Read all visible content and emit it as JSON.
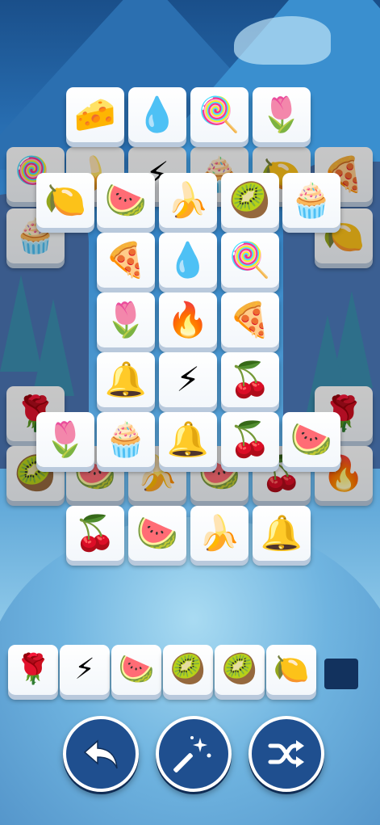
{
  "board": {
    "tiles": [
      {
        "icon": "cheese-icon",
        "glyph": "🧀",
        "layer": "top"
      },
      {
        "icon": "water-drop-icon",
        "glyph": "💧",
        "layer": "top"
      },
      {
        "icon": "popsicle-icon",
        "glyph": "🍭",
        "layer": "top"
      },
      {
        "icon": "tulip-icon",
        "glyph": "🌷",
        "layer": "top"
      },
      {
        "icon": "popsicle-icon",
        "glyph": "🍭",
        "layer": "covered"
      },
      {
        "icon": "banana-icon",
        "glyph": "🍌",
        "layer": "covered"
      },
      {
        "icon": "lightning-icon",
        "glyph": "⚡",
        "layer": "covered"
      },
      {
        "icon": "cupcake-icon",
        "glyph": "🧁",
        "layer": "covered"
      },
      {
        "icon": "lemon-icon",
        "glyph": "🍋",
        "layer": "covered"
      },
      {
        "icon": "pizza-icon",
        "glyph": "🍕",
        "layer": "covered"
      },
      {
        "icon": "lemon-icon",
        "glyph": "🍋",
        "layer": "top"
      },
      {
        "icon": "watermelon-icon",
        "glyph": "🍉",
        "layer": "top"
      },
      {
        "icon": "banana-icon",
        "glyph": "🍌",
        "layer": "top"
      },
      {
        "icon": "kiwi-icon",
        "glyph": "🥝",
        "layer": "top"
      },
      {
        "icon": "cupcake-icon",
        "glyph": "🧁",
        "layer": "top"
      },
      {
        "icon": "cupcake-icon",
        "glyph": "🧁",
        "layer": "covered"
      },
      {
        "icon": "lemon-icon",
        "glyph": "🍋",
        "layer": "covered"
      },
      {
        "icon": "pizza-icon",
        "glyph": "🍕",
        "layer": "top"
      },
      {
        "icon": "water-drop-icon",
        "glyph": "💧",
        "layer": "top"
      },
      {
        "icon": "popsicle-icon",
        "glyph": "🍭",
        "layer": "top"
      },
      {
        "icon": "tulip-icon",
        "glyph": "🌷",
        "layer": "top"
      },
      {
        "icon": "fire-icon",
        "glyph": "🔥",
        "layer": "top"
      },
      {
        "icon": "pizza-icon",
        "glyph": "🍕",
        "layer": "top"
      },
      {
        "icon": "bell-icon",
        "glyph": "🔔",
        "layer": "top"
      },
      {
        "icon": "lightning-icon",
        "glyph": "⚡",
        "layer": "top"
      },
      {
        "icon": "cherry-icon",
        "glyph": "🍒",
        "layer": "top"
      },
      {
        "icon": "rose-icon",
        "glyph": "🌹",
        "layer": "covered"
      },
      {
        "icon": "rose-icon",
        "glyph": "🌹",
        "layer": "covered"
      },
      {
        "icon": "tulip-icon",
        "glyph": "🌷",
        "layer": "top"
      },
      {
        "icon": "cupcake-icon",
        "glyph": "🧁",
        "layer": "top"
      },
      {
        "icon": "bell-icon",
        "glyph": "🔔",
        "layer": "top"
      },
      {
        "icon": "cherry-icon",
        "glyph": "🍒",
        "layer": "top"
      },
      {
        "icon": "watermelon-icon",
        "glyph": "🍉",
        "layer": "top"
      },
      {
        "icon": "kiwi-icon",
        "glyph": "🥝",
        "layer": "covered"
      },
      {
        "icon": "watermelon-icon",
        "glyph": "🍉",
        "layer": "covered"
      },
      {
        "icon": "banana-icon",
        "glyph": "🍌",
        "layer": "covered"
      },
      {
        "icon": "watermelon-icon",
        "glyph": "🍉",
        "layer": "covered"
      },
      {
        "icon": "cherry-icon",
        "glyph": "🍒",
        "layer": "covered"
      },
      {
        "icon": "fire-icon",
        "glyph": "🔥",
        "layer": "covered"
      },
      {
        "icon": "cherry-icon",
        "glyph": "🍒",
        "layer": "top"
      },
      {
        "icon": "watermelon-icon",
        "glyph": "🍉",
        "layer": "top"
      },
      {
        "icon": "banana-icon",
        "glyph": "🍌",
        "layer": "top"
      },
      {
        "icon": "bell-icon",
        "glyph": "🔔",
        "layer": "top"
      }
    ]
  },
  "tray": {
    "capacity": 7,
    "filled": 6,
    "slots": [
      {
        "icon": "rose-icon",
        "glyph": "🌹"
      },
      {
        "icon": "lightning-icon",
        "glyph": "⚡"
      },
      {
        "icon": "watermelon-icon",
        "glyph": "🍉"
      },
      {
        "icon": "kiwi-icon",
        "glyph": "🥝"
      },
      {
        "icon": "kiwi-icon",
        "glyph": "🥝"
      },
      {
        "icon": "lemon-icon",
        "glyph": "🍋"
      }
    ]
  },
  "controls": [
    {
      "name": "undo-button",
      "icon": "undo-arrow-icon"
    },
    {
      "name": "hint-button",
      "icon": "magic-wand-icon"
    },
    {
      "name": "shuffle-button",
      "icon": "shuffle-icon"
    }
  ],
  "colors": {
    "button_fill": "#1f4f8f",
    "button_border": "#ffffff",
    "empty_slot": "#12325e"
  }
}
